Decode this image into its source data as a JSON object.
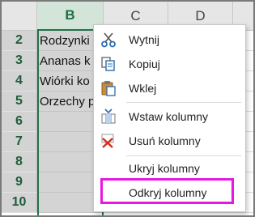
{
  "columns": [
    {
      "label": "B",
      "selected": true
    },
    {
      "label": "C",
      "selected": false
    },
    {
      "label": "D",
      "selected": false
    }
  ],
  "rows": [
    "2",
    "3",
    "4",
    "5",
    "6",
    "7",
    "8",
    "9",
    "10"
  ],
  "column_b_cells": [
    "Rodzynki",
    "Ananas k",
    "Wiórki ko",
    "Orzechy p",
    "",
    "",
    "",
    "",
    ""
  ],
  "context_menu": {
    "cut": "Wytnij",
    "copy": "Kopiuj",
    "paste": "Wklej",
    "insert_columns": "Wstaw kolumny",
    "delete_columns": "Usuń kolumny",
    "hide_columns": "Ukryj kolumny",
    "unhide_columns": "Odkryj kolumny"
  },
  "icons": {
    "cut": "scissors-icon",
    "copy": "copy-icon",
    "paste": "paste-icon",
    "insert": "insert-columns-icon",
    "delete": "delete-columns-icon"
  },
  "colors": {
    "selection_green": "#217346",
    "highlight_magenta": "#e519e5",
    "selected_header": "#d3e4d9"
  }
}
